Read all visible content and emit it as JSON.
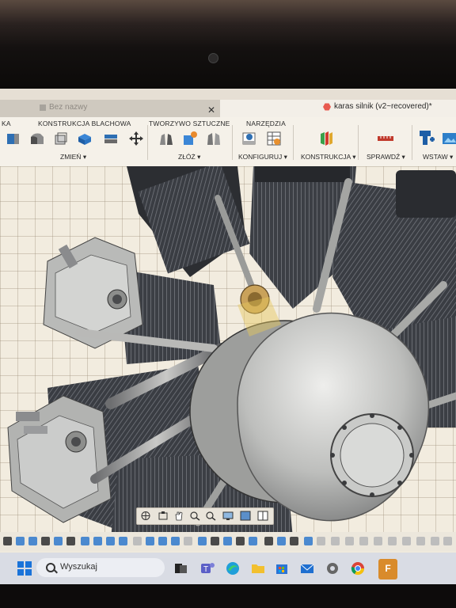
{
  "tabs": [
    {
      "label": "Bez nazwy"
    },
    {
      "label": "karas silnik (v2~recovered)*"
    }
  ],
  "toolbar": {
    "partial_label": "KA",
    "groups": [
      {
        "label": "KONSTRUKCJA BLACHOWA",
        "dropdown": "ZMIEŃ"
      },
      {
        "label": "TWORZYWO SZTUCZNE",
        "dropdown": "ZŁÓŻ"
      },
      {
        "label": "NARZĘDZIA",
        "dropdown": "KONFIGURUJ"
      },
      {
        "dropdown": "KONSTRUKCJA"
      },
      {
        "dropdown": "SPRAWDŹ"
      },
      {
        "dropdown": "WSTAW"
      }
    ]
  },
  "taskbar": {
    "search_placeholder": "Wyszukaj",
    "fusion_badge": "F"
  },
  "colors": {
    "accent_blue": "#1a73d9",
    "toolbar_bg": "#f5f1e9",
    "model_gray": "#b7b8b6",
    "dark_metal": "#3a3c40"
  }
}
